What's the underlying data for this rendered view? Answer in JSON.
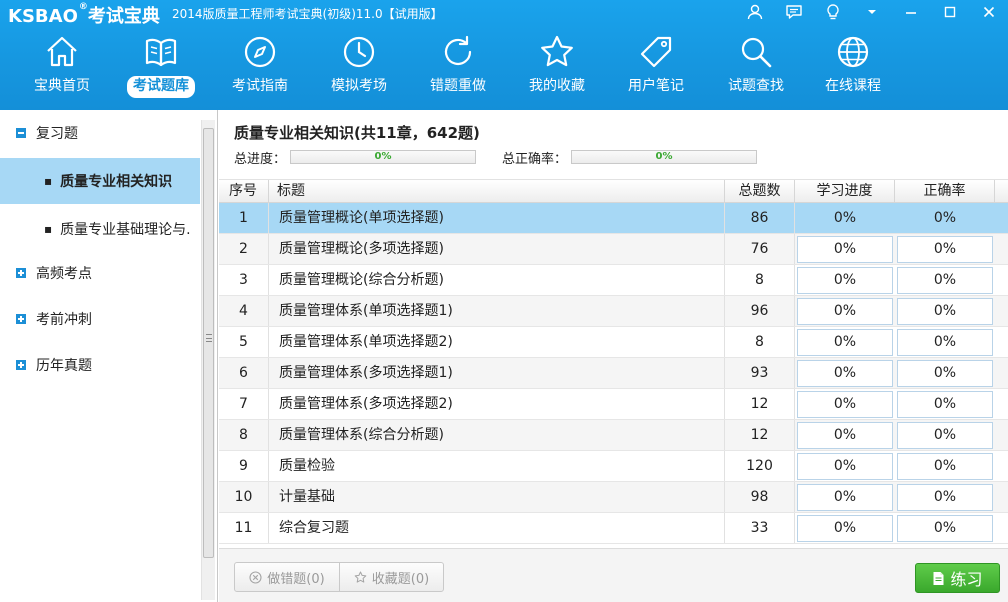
{
  "app": {
    "logo": "KSBAO",
    "logo_mark": "®",
    "logo_cn": "考试宝典",
    "window_title": "2014版质量工程师考试宝典(初级)11.0【试用版】"
  },
  "nav": {
    "items": [
      {
        "label": "宝典首页",
        "icon": "home-icon"
      },
      {
        "label": "考试题库",
        "icon": "book-icon"
      },
      {
        "label": "考试指南",
        "icon": "compass-icon"
      },
      {
        "label": "模拟考场",
        "icon": "clock-icon"
      },
      {
        "label": "错题重做",
        "icon": "refresh-icon"
      },
      {
        "label": "我的收藏",
        "icon": "star-icon"
      },
      {
        "label": "用户笔记",
        "icon": "tag-icon"
      },
      {
        "label": "试题查找",
        "icon": "search-icon"
      },
      {
        "label": "在线课程",
        "icon": "globe-icon"
      }
    ],
    "active": "考试题库"
  },
  "sidebar": {
    "groups": [
      {
        "label": "复习题",
        "expanded": true
      },
      {
        "label": "高频考点",
        "expanded": false
      },
      {
        "label": "考前冲刺",
        "expanded": false
      },
      {
        "label": "历年真题",
        "expanded": false
      }
    ],
    "subitems": [
      {
        "label": "质量专业相关知识",
        "active": true
      },
      {
        "label": "质量专业基础理论与.",
        "active": false
      }
    ]
  },
  "main": {
    "title": "质量专业相关知识(共11章，642题)",
    "total_progress_label": "总进度：",
    "total_progress_value": "0%",
    "total_accuracy_label": "总正确率：",
    "total_accuracy_value": "0%",
    "headers": {
      "no": "序号",
      "title": "标题",
      "total": "总题数",
      "progress": "学习进度",
      "accuracy": "正确率"
    },
    "rows": [
      {
        "no": "1",
        "title": "质量管理概论(单项选择题)",
        "total": "86",
        "progress": "0%",
        "accuracy": "0%"
      },
      {
        "no": "2",
        "title": "质量管理概论(多项选择题)",
        "total": "76",
        "progress": "0%",
        "accuracy": "0%"
      },
      {
        "no": "3",
        "title": "质量管理概论(综合分析题)",
        "total": "8",
        "progress": "0%",
        "accuracy": "0%"
      },
      {
        "no": "4",
        "title": "质量管理体系(单项选择题1)",
        "total": "96",
        "progress": "0%",
        "accuracy": "0%"
      },
      {
        "no": "5",
        "title": "质量管理体系(单项选择题2)",
        "total": "8",
        "progress": "0%",
        "accuracy": "0%"
      },
      {
        "no": "6",
        "title": "质量管理体系(多项选择题1)",
        "total": "93",
        "progress": "0%",
        "accuracy": "0%"
      },
      {
        "no": "7",
        "title": "质量管理体系(多项选择题2)",
        "total": "12",
        "progress": "0%",
        "accuracy": "0%"
      },
      {
        "no": "8",
        "title": "质量管理体系(综合分析题)",
        "total": "12",
        "progress": "0%",
        "accuracy": "0%"
      },
      {
        "no": "9",
        "title": "质量检验",
        "total": "120",
        "progress": "0%",
        "accuracy": "0%"
      },
      {
        "no": "10",
        "title": "计量基础",
        "total": "98",
        "progress": "0%",
        "accuracy": "0%"
      },
      {
        "no": "11",
        "title": "综合复习题",
        "total": "33",
        "progress": "0%",
        "accuracy": "0%"
      }
    ],
    "selected_row": 0
  },
  "footer": {
    "wrong_label": "做错题(0)",
    "fav_label": "收藏题(0)",
    "practice_label": "练习"
  },
  "colors": {
    "header_blue": "#1697e0",
    "selection": "#a7d8f5",
    "practice_green": "#3aa82c"
  }
}
